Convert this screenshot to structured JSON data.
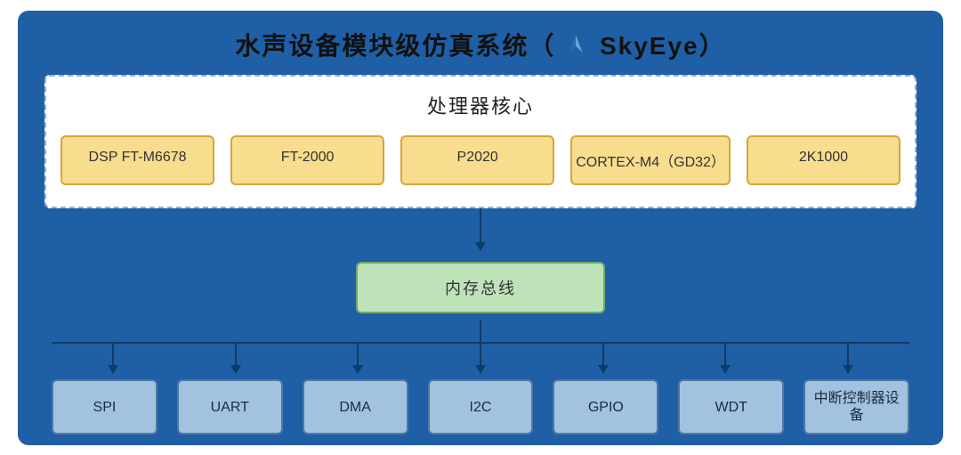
{
  "title_prefix": "水声设备模块级仿真系统（",
  "title_brand": "SkyEye）",
  "icon_name": "skyeye-logo",
  "cpu_panel": {
    "title": "处理器核心",
    "items": [
      "DSP FT-M6678",
      "FT-2000",
      "P2020",
      "CORTEX-M4（GD32）",
      "2K1000"
    ]
  },
  "bus_label": "内存总线",
  "peripherals": [
    "SPI",
    "UART",
    "DMA",
    "I2C",
    "GPIO",
    "WDT",
    "中断控制器设备"
  ]
}
